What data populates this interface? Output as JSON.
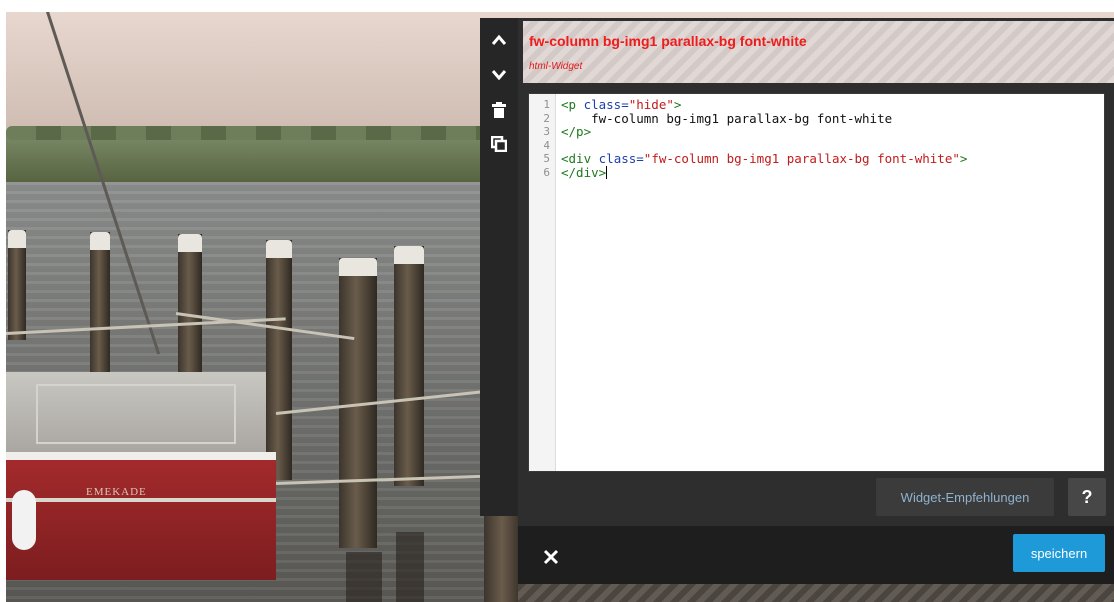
{
  "panel": {
    "title": "fw-column bg-img1 parallax-bg font-white",
    "subtitle": "html-Widget",
    "title_color": "#f01b1b"
  },
  "toolbar": {
    "buttons": [
      {
        "icon": "chevron-up-icon"
      },
      {
        "icon": "chevron-down-icon"
      },
      {
        "icon": "trash-icon"
      },
      {
        "icon": "duplicate-icon"
      }
    ]
  },
  "editor": {
    "line_numbers": [
      "1",
      "2",
      "3",
      "4",
      "5",
      "6"
    ],
    "lines": [
      {
        "tag_open": "<p ",
        "attr": "class=",
        "str": "\"hide\"",
        "tag_close": ">"
      },
      {
        "text": "    fw-column bg-img1 parallax-bg font-white"
      },
      {
        "tag": "</p>"
      },
      {
        "text": ""
      },
      {
        "tag_open": "<div ",
        "attr": "class=",
        "str": "\"fw-column bg-img1 parallax-bg font-white\"",
        "tag_close": ">"
      },
      {
        "tag": "</div>"
      }
    ]
  },
  "actions": {
    "recommend_label": "Widget-Empfehlungen",
    "help_label": "?",
    "save_label": "speichern",
    "save_color": "#1e9ad8",
    "close_icon": "close-icon"
  },
  "background": {
    "boat_name": "EMEKADE"
  }
}
